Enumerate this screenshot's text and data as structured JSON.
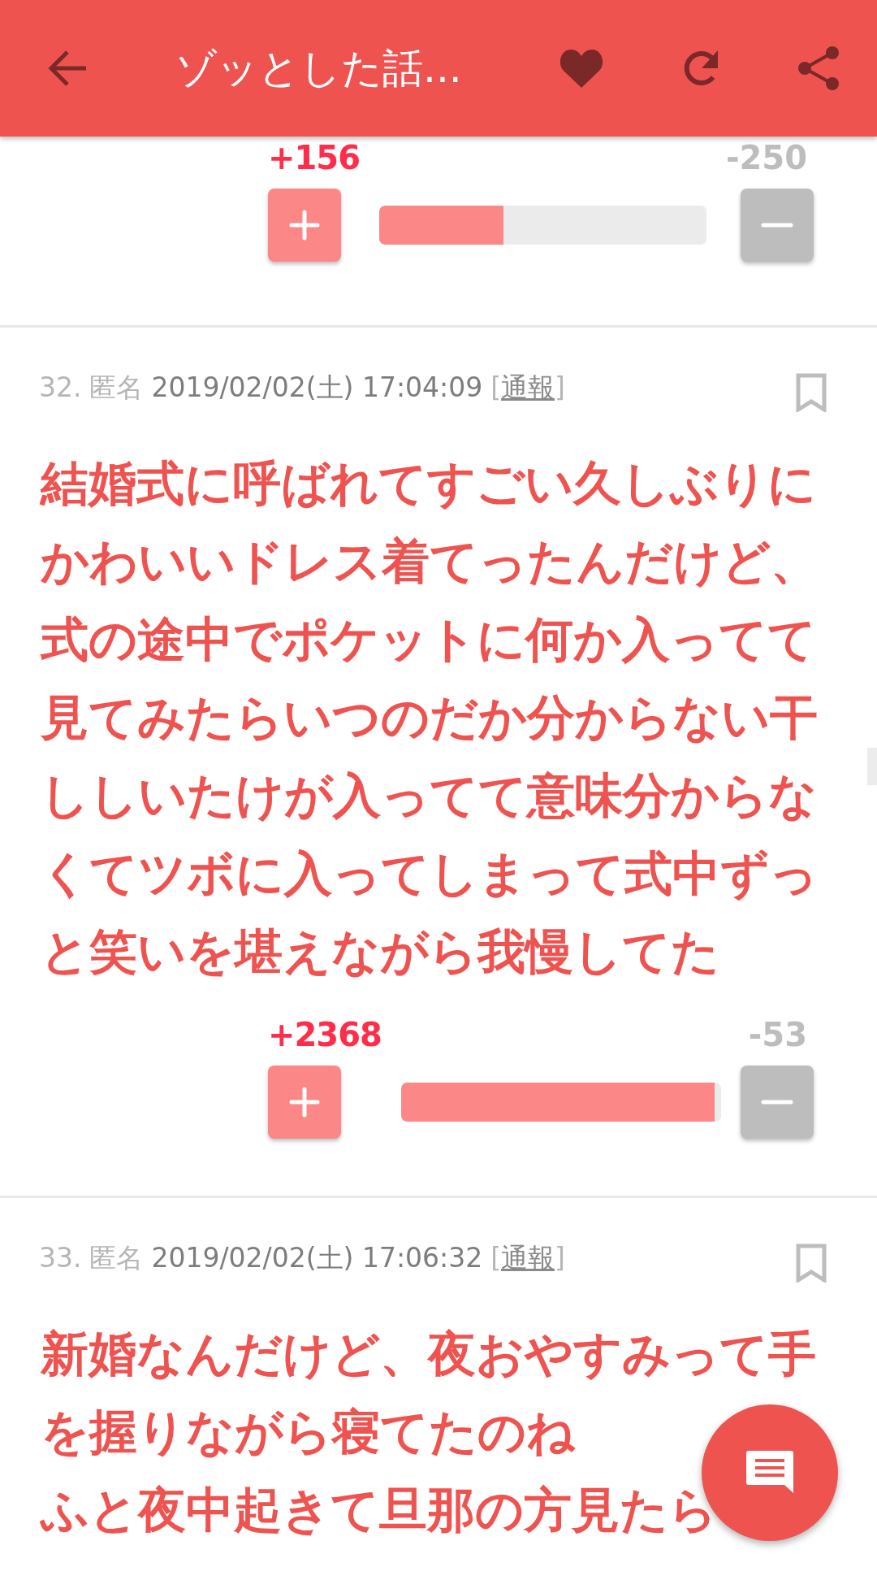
{
  "header": {
    "title": "ゾッとした話..."
  },
  "top_votes": {
    "plus": "+156",
    "minus": "-250",
    "level": 0.38
  },
  "comments": [
    {
      "number": "32.",
      "name": "匿名",
      "date": "2019/02/02(土) 17:04:09",
      "report": [
        "[",
        "通報",
        "]"
      ],
      "body": [
        "結婚式に呼ばれてすごい久しぶりにかわいいドレス着てったんだけど、式の途中でポケットに何か入ってて見てみたらいつのだか分からない干ししいたけが入ってて意味分からなくてツボに入ってしまって式中ずっと笑いを堪えながら我慢してた"
      ],
      "votes": {
        "plus": "+2368",
        "minus": "-53",
        "level": 0.98
      }
    },
    {
      "number": "33.",
      "name": "匿名",
      "date": "2019/02/02(土) 17:06:32",
      "report": [
        "[",
        "通報",
        "]"
      ],
      "body": [
        "新婚なんだけど、夜おやすみって手を握りながら寝てたのね",
        "ふと夜中起きて旦那の方見たら"
      ]
    }
  ]
}
